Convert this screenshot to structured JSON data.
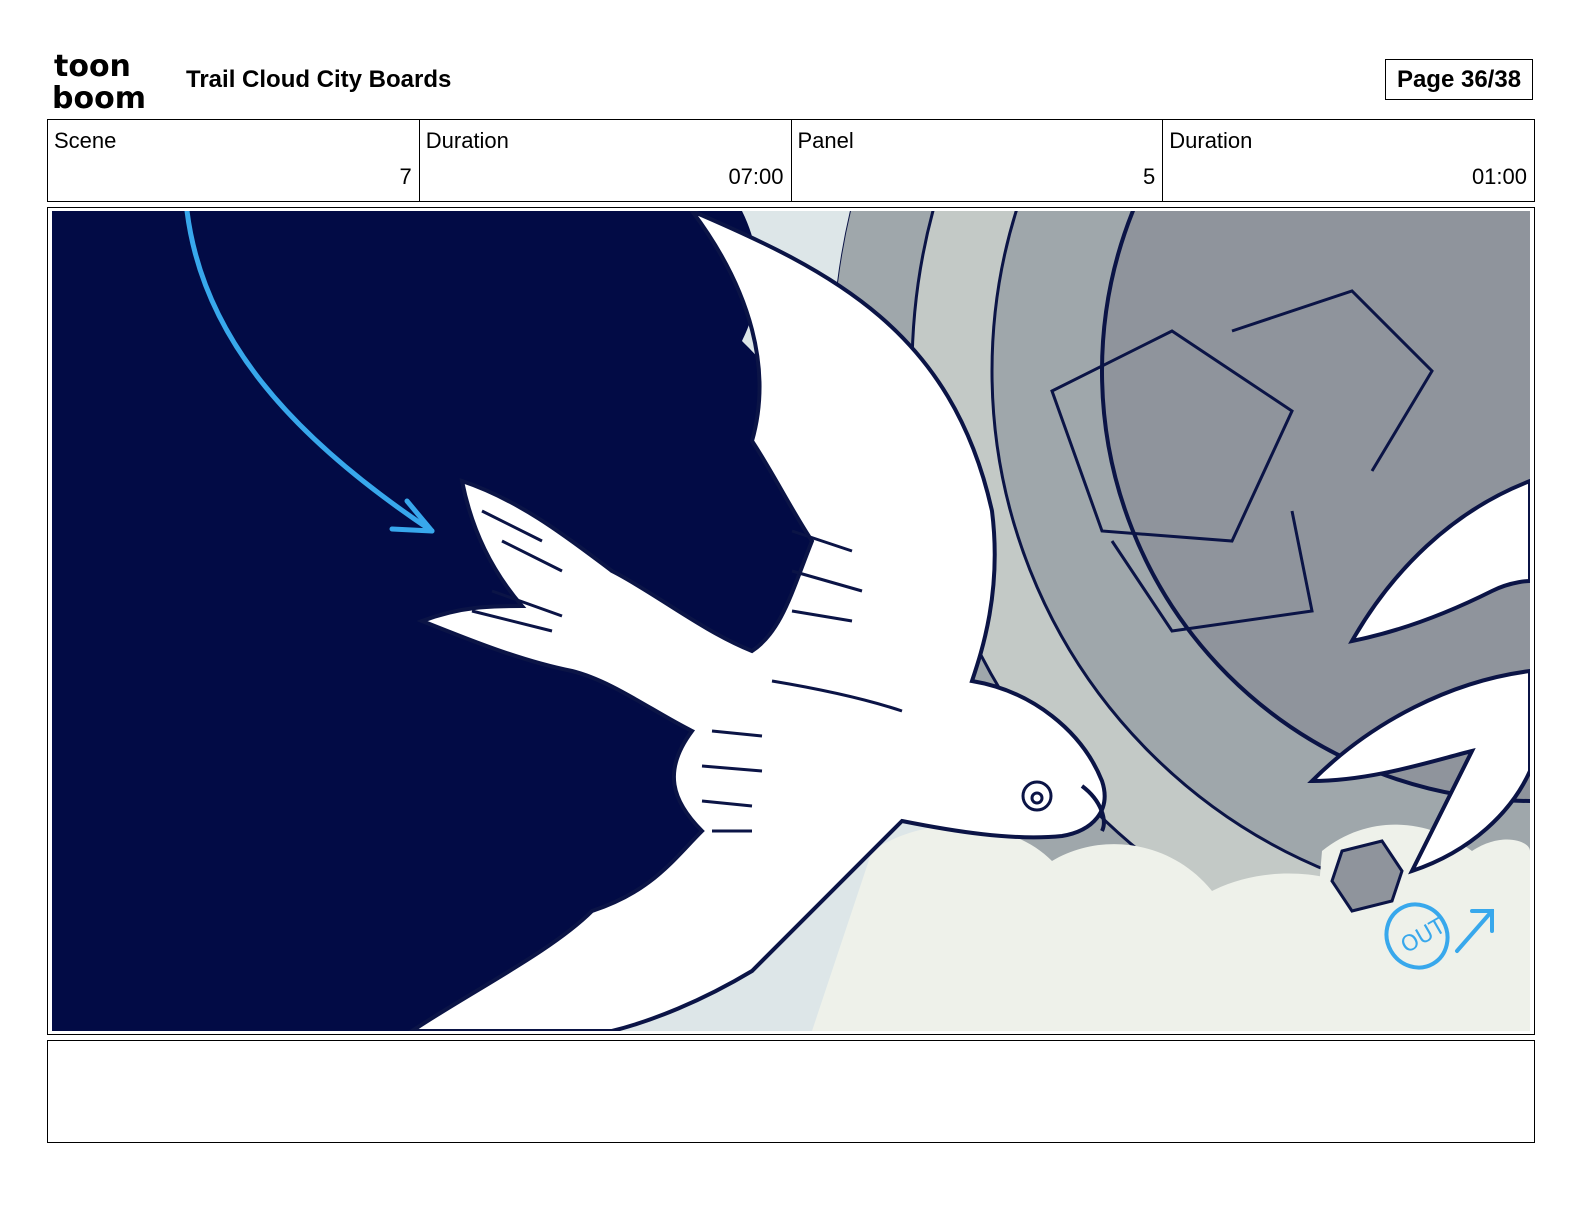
{
  "header": {
    "logo_text_line1": "toon",
    "logo_text_line2": "boom",
    "title": "Trail Cloud City Boards",
    "page_label": "Page 36/38"
  },
  "info": {
    "scene_label": "Scene",
    "scene_value": "7",
    "scene_duration_label": "Duration",
    "scene_duration_value": "07:00",
    "panel_label": "Panel",
    "panel_value": "5",
    "panel_duration_label": "Duration",
    "panel_duration_value": "01:00"
  },
  "panel_image": {
    "annotation_text": "OUT",
    "colors": {
      "night_sky": "#020b45",
      "ink": "#0b1446",
      "arrow_blue": "#38a8ec",
      "stone_gray": "#9fa7ab",
      "stone_light": "#c3c9c6",
      "cloud": "#eef1ea",
      "sky_pale": "#dde6e8"
    }
  },
  "notes": {
    "text": ""
  }
}
